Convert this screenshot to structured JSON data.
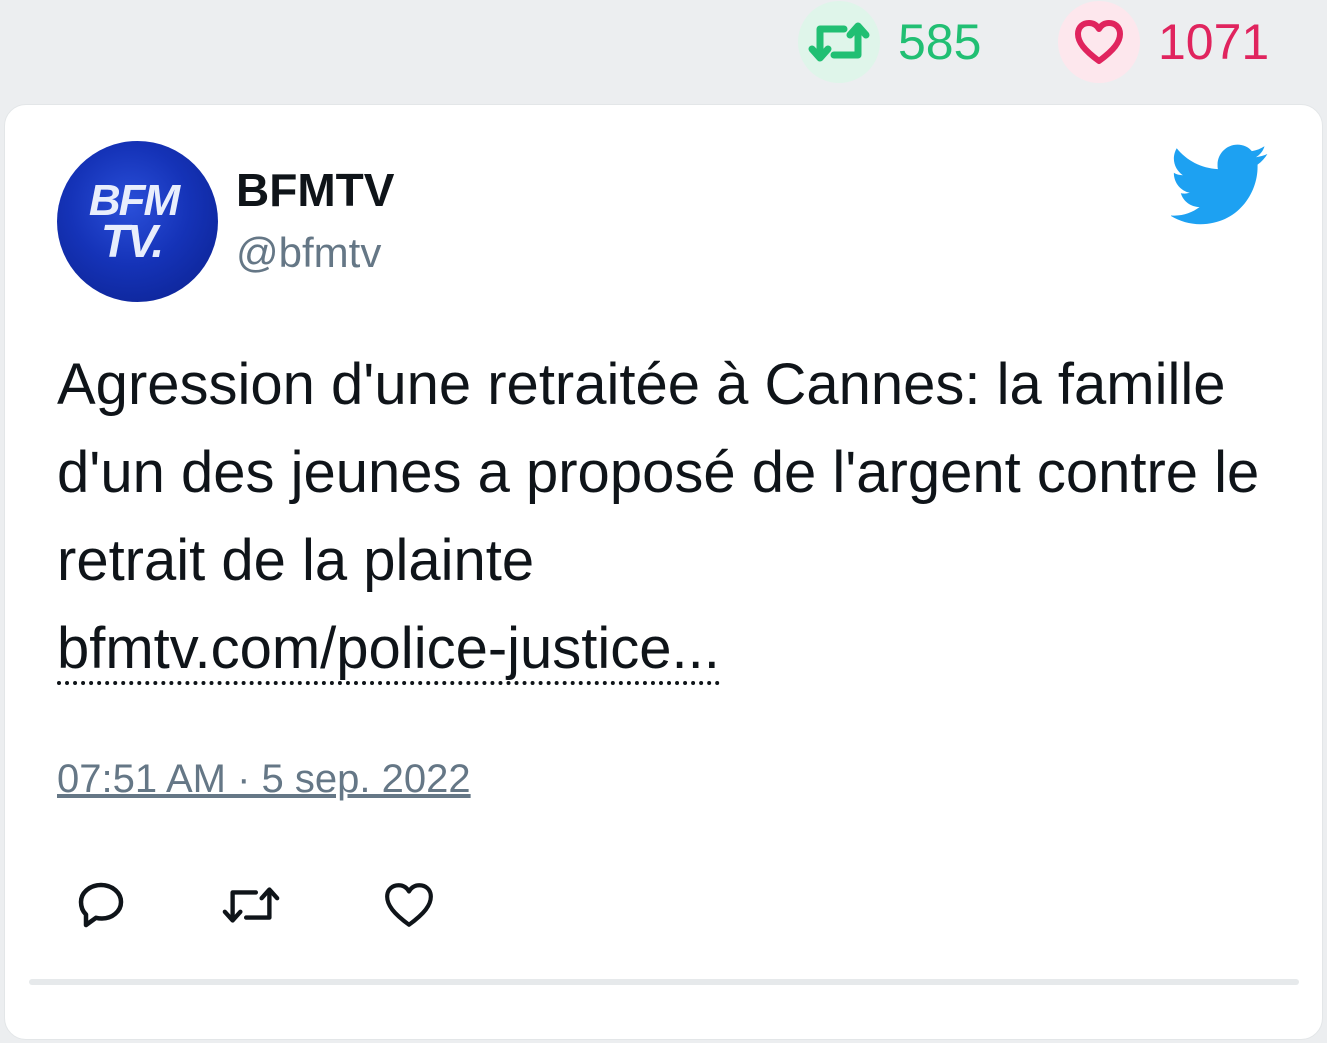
{
  "stats": {
    "retweet_count": "585",
    "like_count": "1071",
    "retweet_color": "#21bf73",
    "like_color": "#e0245e"
  },
  "tweet": {
    "avatar_logo_text": [
      "BFM",
      "TV."
    ],
    "author_name": "BFMTV",
    "author_handle": "@bfmtv",
    "text": "Agression d'une retraitée à Cannes: la famille d'un des jeunes a proposé de l'argent contre le retrait de la plainte",
    "link_text": "bfmtv.com/police-justice...",
    "timestamp": "07:51 AM · 5 sep. 2022"
  },
  "icons": {
    "platform": "twitter-bird-icon",
    "stats": [
      "retweet-icon",
      "heart-icon"
    ],
    "actions": [
      "reply-icon",
      "retweet-icon",
      "like-icon"
    ]
  }
}
